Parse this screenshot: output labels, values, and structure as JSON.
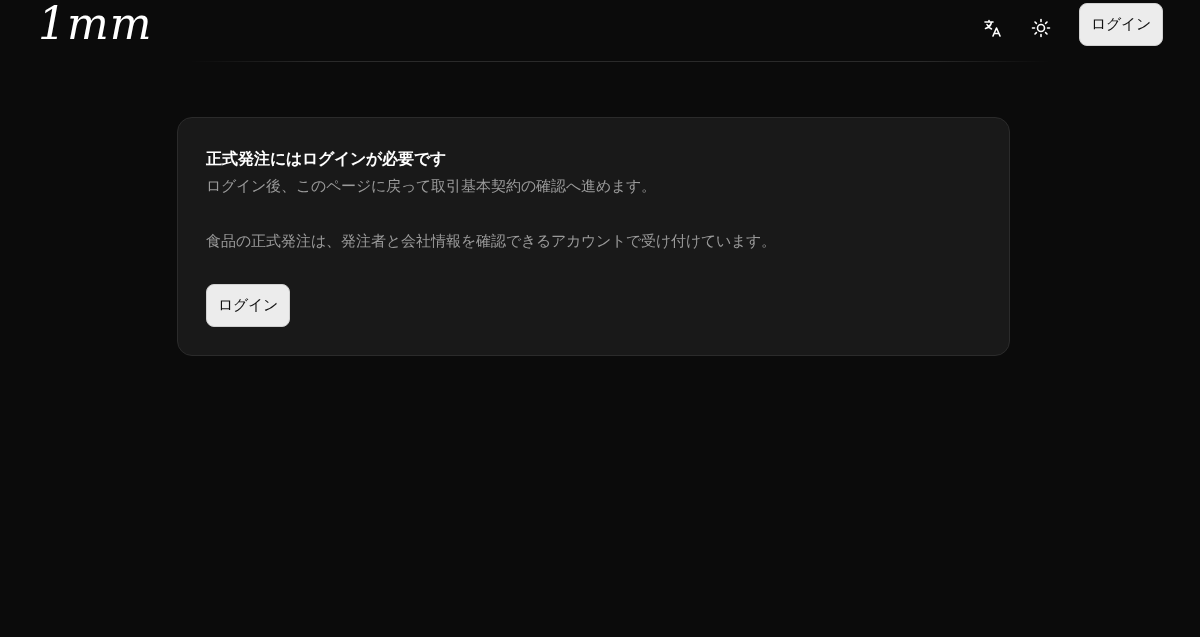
{
  "header": {
    "logo": "1mm",
    "login_button": "ログイン"
  },
  "notice": {
    "title": "正式発注にはログインが必要です",
    "subtitle": "ログイン後、このページに戻って取引基本契約の確認へ進めます。",
    "body": "食品の正式発注は、発注者と会社情報を確認できるアカウントで受け付けています。",
    "button": "ログイン"
  }
}
